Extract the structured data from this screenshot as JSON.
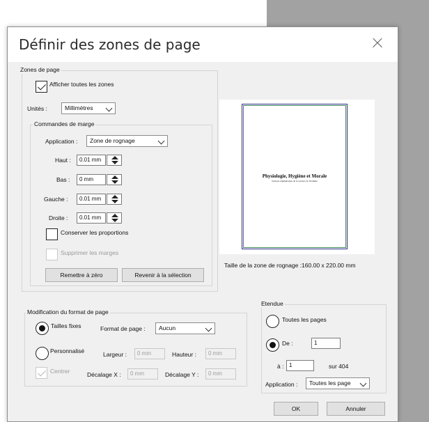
{
  "dialog": {
    "title": "Définir des zones de page"
  },
  "zones": {
    "group_label": "Zones de page",
    "show_all_label": "Afficher toutes les zones",
    "units_label": "Unités :",
    "units_value": "Millimètres"
  },
  "margins": {
    "group_label": "Commandes de marge",
    "application_label": "Application :",
    "application_value": "Zone de rognage",
    "top_label": "Haut :",
    "top_value": "0.01 mm",
    "bottom_label": "Bas :",
    "bottom_value": "0 mm",
    "left_label": "Gauche :",
    "left_value": "0.01 mm",
    "right_label": "Droite :",
    "right_value": "0.01 mm",
    "keep_ratio_label": "Conserver les proportions",
    "remove_margins_label": "Supprimer les marges",
    "reset_button": "Remettre à zéro",
    "revert_button": "Revenir à la sélection"
  },
  "preview": {
    "page_title": "Physiologie, Hygiène et Morale",
    "page_subtitle": "Notions élémentaires de la science de l'homme",
    "size_caption": "Taille de la zone de rognage :160.00 x 220.00 mm"
  },
  "format": {
    "group_label": "Modification du format de page",
    "fixed_label": "Tailles fixes",
    "custom_label": "Personnalisé",
    "page_format_label": "Format de page :",
    "page_format_value": "Aucun",
    "width_label": "Largeur :",
    "width_value": "0 mm",
    "height_label": "Hauteur :",
    "height_value": "0 mm",
    "center_label": "Centrer",
    "offset_x_label": "Décalage X :",
    "offset_x_value": "0 mm",
    "offset_y_label": "Décalage Y :",
    "offset_y_value": "0 mm"
  },
  "range": {
    "group_label": "Etendue",
    "all_pages_label": "Toutes les pages",
    "from_label": "De :",
    "from_value": "1",
    "to_label": "à :",
    "to_value": "1",
    "of_total": "sur 404",
    "application_label": "Application :",
    "application_value": "Toutes les page"
  },
  "buttons": {
    "ok": "OK",
    "cancel": "Annuler"
  }
}
